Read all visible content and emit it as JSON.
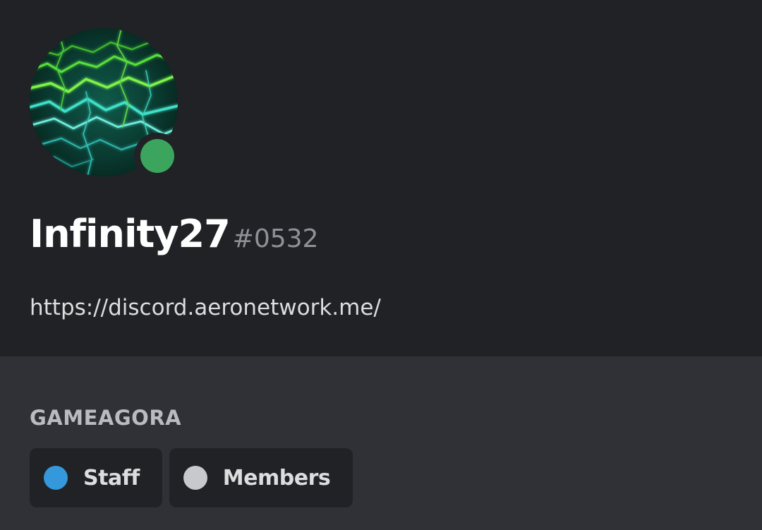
{
  "profile": {
    "username": "Infinity27",
    "discriminator": "#0532",
    "about_link": "https://discord.aeronetwork.me/",
    "status": "online",
    "status_color": "#3ba55d",
    "avatar_icon": "green-lightning-avatar"
  },
  "roles_section": {
    "server_name": "GAMEAGORA",
    "roles": [
      {
        "label": "Staff",
        "color": "#3498db"
      },
      {
        "label": "Members",
        "color": "#c7c9cc"
      }
    ]
  },
  "colors": {
    "header_bg": "#202225",
    "section_bg": "#2f3136"
  }
}
